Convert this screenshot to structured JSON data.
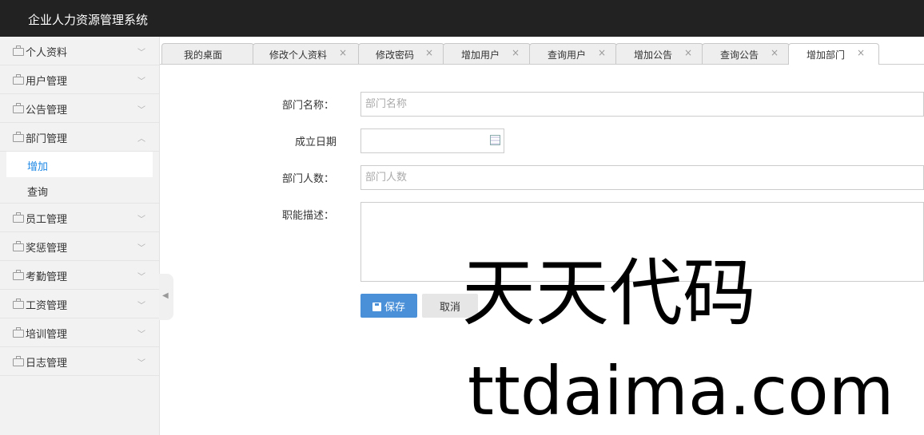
{
  "app": {
    "title": "企业人力资源管理系统"
  },
  "sidebar": {
    "groups": [
      {
        "label": "个人资料"
      },
      {
        "label": "用户管理"
      },
      {
        "label": "公告管理"
      },
      {
        "label": "部门管理",
        "expanded": true,
        "items": [
          {
            "label": "增加",
            "active": true
          },
          {
            "label": "查询"
          }
        ]
      },
      {
        "label": "员工管理"
      },
      {
        "label": "奖惩管理"
      },
      {
        "label": "考勤管理"
      },
      {
        "label": "工资管理"
      },
      {
        "label": "培训管理"
      },
      {
        "label": "日志管理"
      }
    ]
  },
  "tabs": [
    {
      "label": "我的桌面"
    },
    {
      "label": "修改个人资料"
    },
    {
      "label": "修改密码"
    },
    {
      "label": "增加用户"
    },
    {
      "label": "查询用户"
    },
    {
      "label": "增加公告"
    },
    {
      "label": "查询公告"
    },
    {
      "label": "增加部门",
      "active": true
    }
  ],
  "form": {
    "name_label": "部门名称：",
    "name_placeholder": "部门名称",
    "date_label": "成立日期",
    "count_label": "部门人数：",
    "count_placeholder": "部门人数",
    "desc_label": "职能描述：",
    "save_label": "保存",
    "cancel_label": "取消"
  },
  "watermark": {
    "line1": "天天代码",
    "line2": "ttdaima.com"
  },
  "colors": {
    "topbar": "#222222",
    "accent": "#4a90d9",
    "active_link": "#1e88e5"
  },
  "icons": {
    "nav": "briefcase-icon",
    "chevron_collapsed": "chevron-down-icon",
    "chevron_expanded": "chevron-up-icon",
    "tab_close": "close-icon",
    "calendar": "calendar-icon",
    "save": "floppy-disk-icon",
    "collapse": "caret-left-icon"
  }
}
